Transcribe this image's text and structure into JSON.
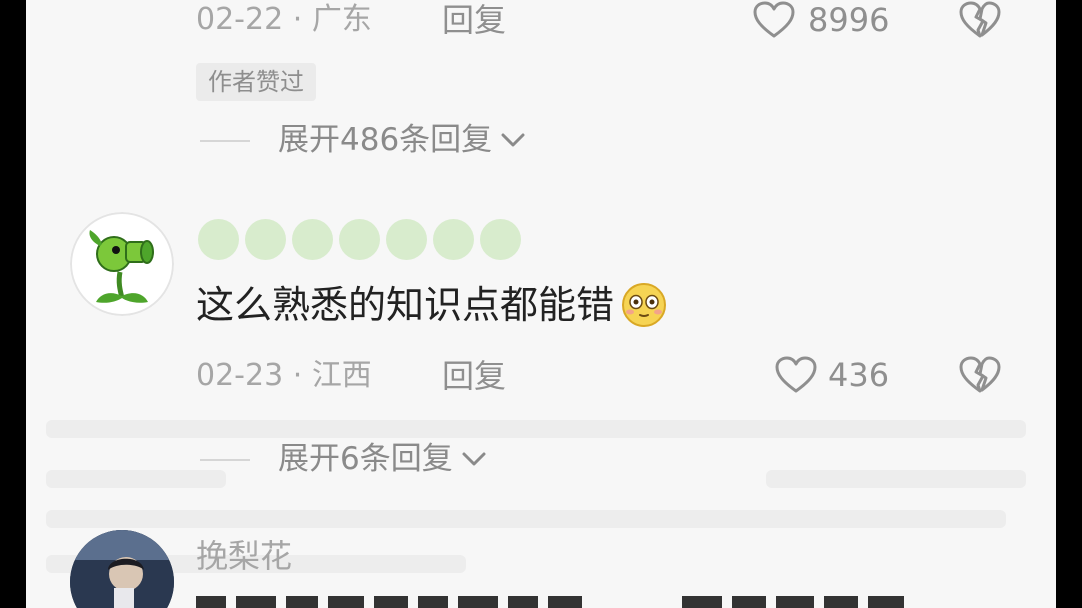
{
  "comment_top": {
    "date": "02-22",
    "location": "广东",
    "reply_label": "回复",
    "like_count": "8996",
    "author_badge": "作者赞过",
    "expand_replies": "展开486条回复"
  },
  "comment_mid": {
    "text": "这么熟悉的知识点都能错",
    "emoji": "😳",
    "date": "02-23",
    "location": "江西",
    "reply_label": "回复",
    "like_count": "436",
    "expand_replies": "展开6条回复"
  },
  "comment_bottom": {
    "username": "挽梨花"
  },
  "colors": {
    "background": "#f7f7f7",
    "meta_text": "#a6a6a6",
    "body_text": "#222222",
    "blurred_name": "#d8eccd",
    "outer_frame": "#000000"
  },
  "icons": [
    "heart-outline-icon",
    "broken-heart-icon",
    "chevron-down-icon",
    "peashooter-avatar",
    "photo-avatar"
  ]
}
